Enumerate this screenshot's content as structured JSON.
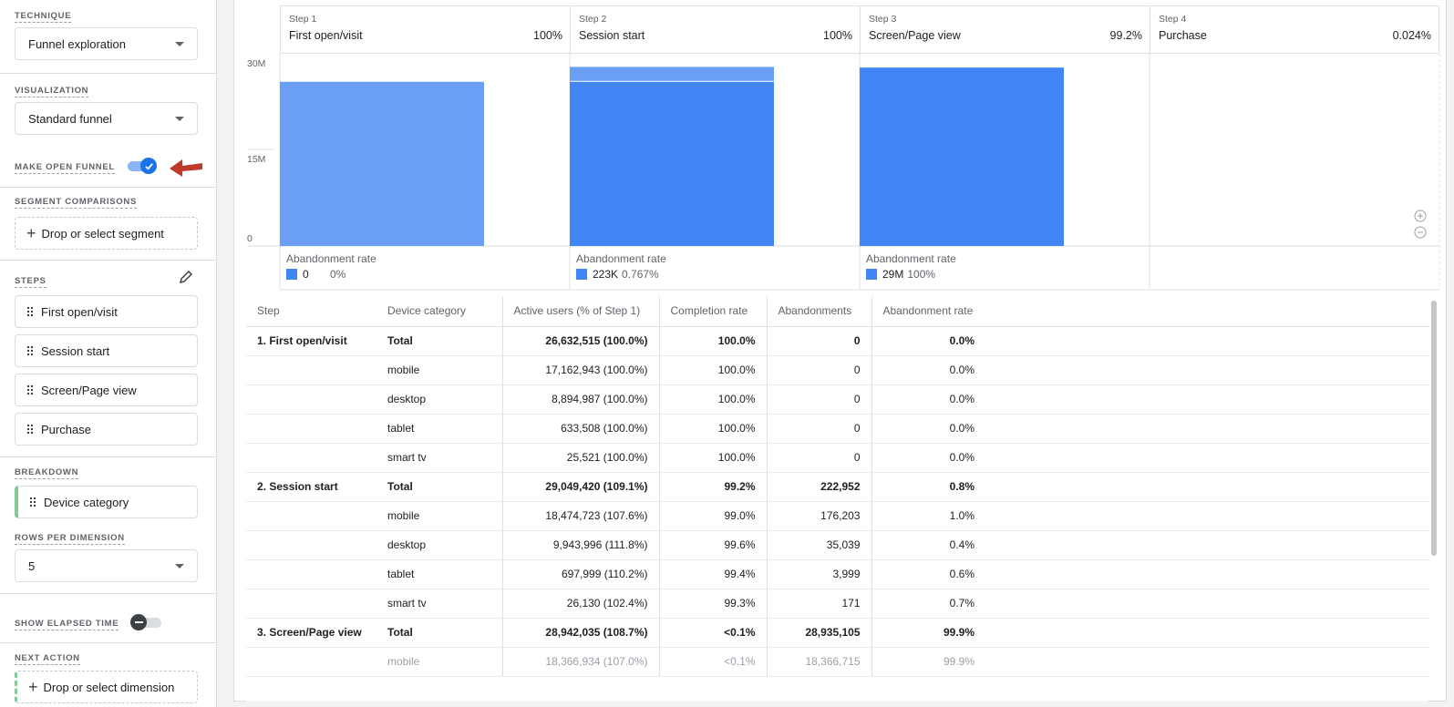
{
  "sidebar": {
    "technique": {
      "label": "TECHNIQUE",
      "value": "Funnel exploration"
    },
    "visualization": {
      "label": "VISUALIZATION",
      "value": "Standard funnel"
    },
    "open_funnel": {
      "label": "MAKE OPEN FUNNEL",
      "on": true
    },
    "segments": {
      "label": "SEGMENT COMPARISONS",
      "placeholder": "Drop or select segment"
    },
    "steps": {
      "label": "STEPS",
      "items": [
        "First open/visit",
        "Session start",
        "Screen/Page view",
        "Purchase"
      ]
    },
    "breakdown": {
      "label": "BREAKDOWN",
      "value": "Device category"
    },
    "rows_per_dimension": {
      "label": "ROWS PER DIMENSION",
      "value": "5"
    },
    "elapsed_time": {
      "label": "SHOW ELAPSED TIME",
      "on": false
    },
    "next_action": {
      "label": "NEXT ACTION",
      "placeholder": "Drop or select dimension"
    }
  },
  "chart_data": {
    "type": "bar",
    "categories": [
      "First open/visit",
      "Session start",
      "Screen/Page view",
      "Purchase"
    ],
    "step_labels": [
      "Step 1",
      "Step 2",
      "Step 3",
      "Step 4"
    ],
    "step_percents": [
      "100%",
      "100%",
      "99.2%",
      "0.024%"
    ],
    "series": [
      {
        "name": "Active users",
        "values": [
          26632515,
          29049420,
          28942035,
          6950
        ]
      }
    ],
    "y_ticks": [
      "30M",
      "15M",
      "0"
    ],
    "ylim": [
      0,
      30000000
    ],
    "abandonment_label": "Abandonment rate",
    "abandonment": [
      {
        "count": "0",
        "rate": "0%"
      },
      {
        "count": "223K",
        "rate": "0.767%"
      },
      {
        "count": "29M",
        "rate": "100%"
      }
    ],
    "colors": {
      "bar_light": "#6b9ff3",
      "bar": "#4285f4"
    }
  },
  "table": {
    "headers": [
      "Step",
      "Device category",
      "Active users (% of Step 1)",
      "Completion rate",
      "Abandonments",
      "Abandonment rate"
    ],
    "rows": [
      [
        "1. First open/visit",
        "Total",
        "26,632,515 (100.0%)",
        "100.0%",
        "0",
        "0.0%"
      ],
      [
        "",
        "mobile",
        "17,162,943 (100.0%)",
        "100.0%",
        "0",
        "0.0%"
      ],
      [
        "",
        "desktop",
        "8,894,987 (100.0%)",
        "100.0%",
        "0",
        "0.0%"
      ],
      [
        "",
        "tablet",
        "633,508 (100.0%)",
        "100.0%",
        "0",
        "0.0%"
      ],
      [
        "",
        "smart tv",
        "25,521 (100.0%)",
        "100.0%",
        "0",
        "0.0%"
      ],
      [
        "2. Session start",
        "Total",
        "29,049,420 (109.1%)",
        "99.2%",
        "222,952",
        "0.8%"
      ],
      [
        "",
        "mobile",
        "18,474,723 (107.6%)",
        "99.0%",
        "176,203",
        "1.0%"
      ],
      [
        "",
        "desktop",
        "9,943,996 (111.8%)",
        "99.6%",
        "35,039",
        "0.4%"
      ],
      [
        "",
        "tablet",
        "697,999 (110.2%)",
        "99.4%",
        "3,999",
        "0.6%"
      ],
      [
        "",
        "smart tv",
        "26,130 (102.4%)",
        "99.3%",
        "171",
        "0.7%"
      ],
      [
        "3. Screen/Page view",
        "Total",
        "28,942,035 (108.7%)",
        "<0.1%",
        "28,935,105",
        "99.9%"
      ],
      [
        "",
        "mobile",
        "18,366,934 (107.0%)",
        "<0.1%",
        "18,366,715",
        "99.9%"
      ]
    ]
  }
}
